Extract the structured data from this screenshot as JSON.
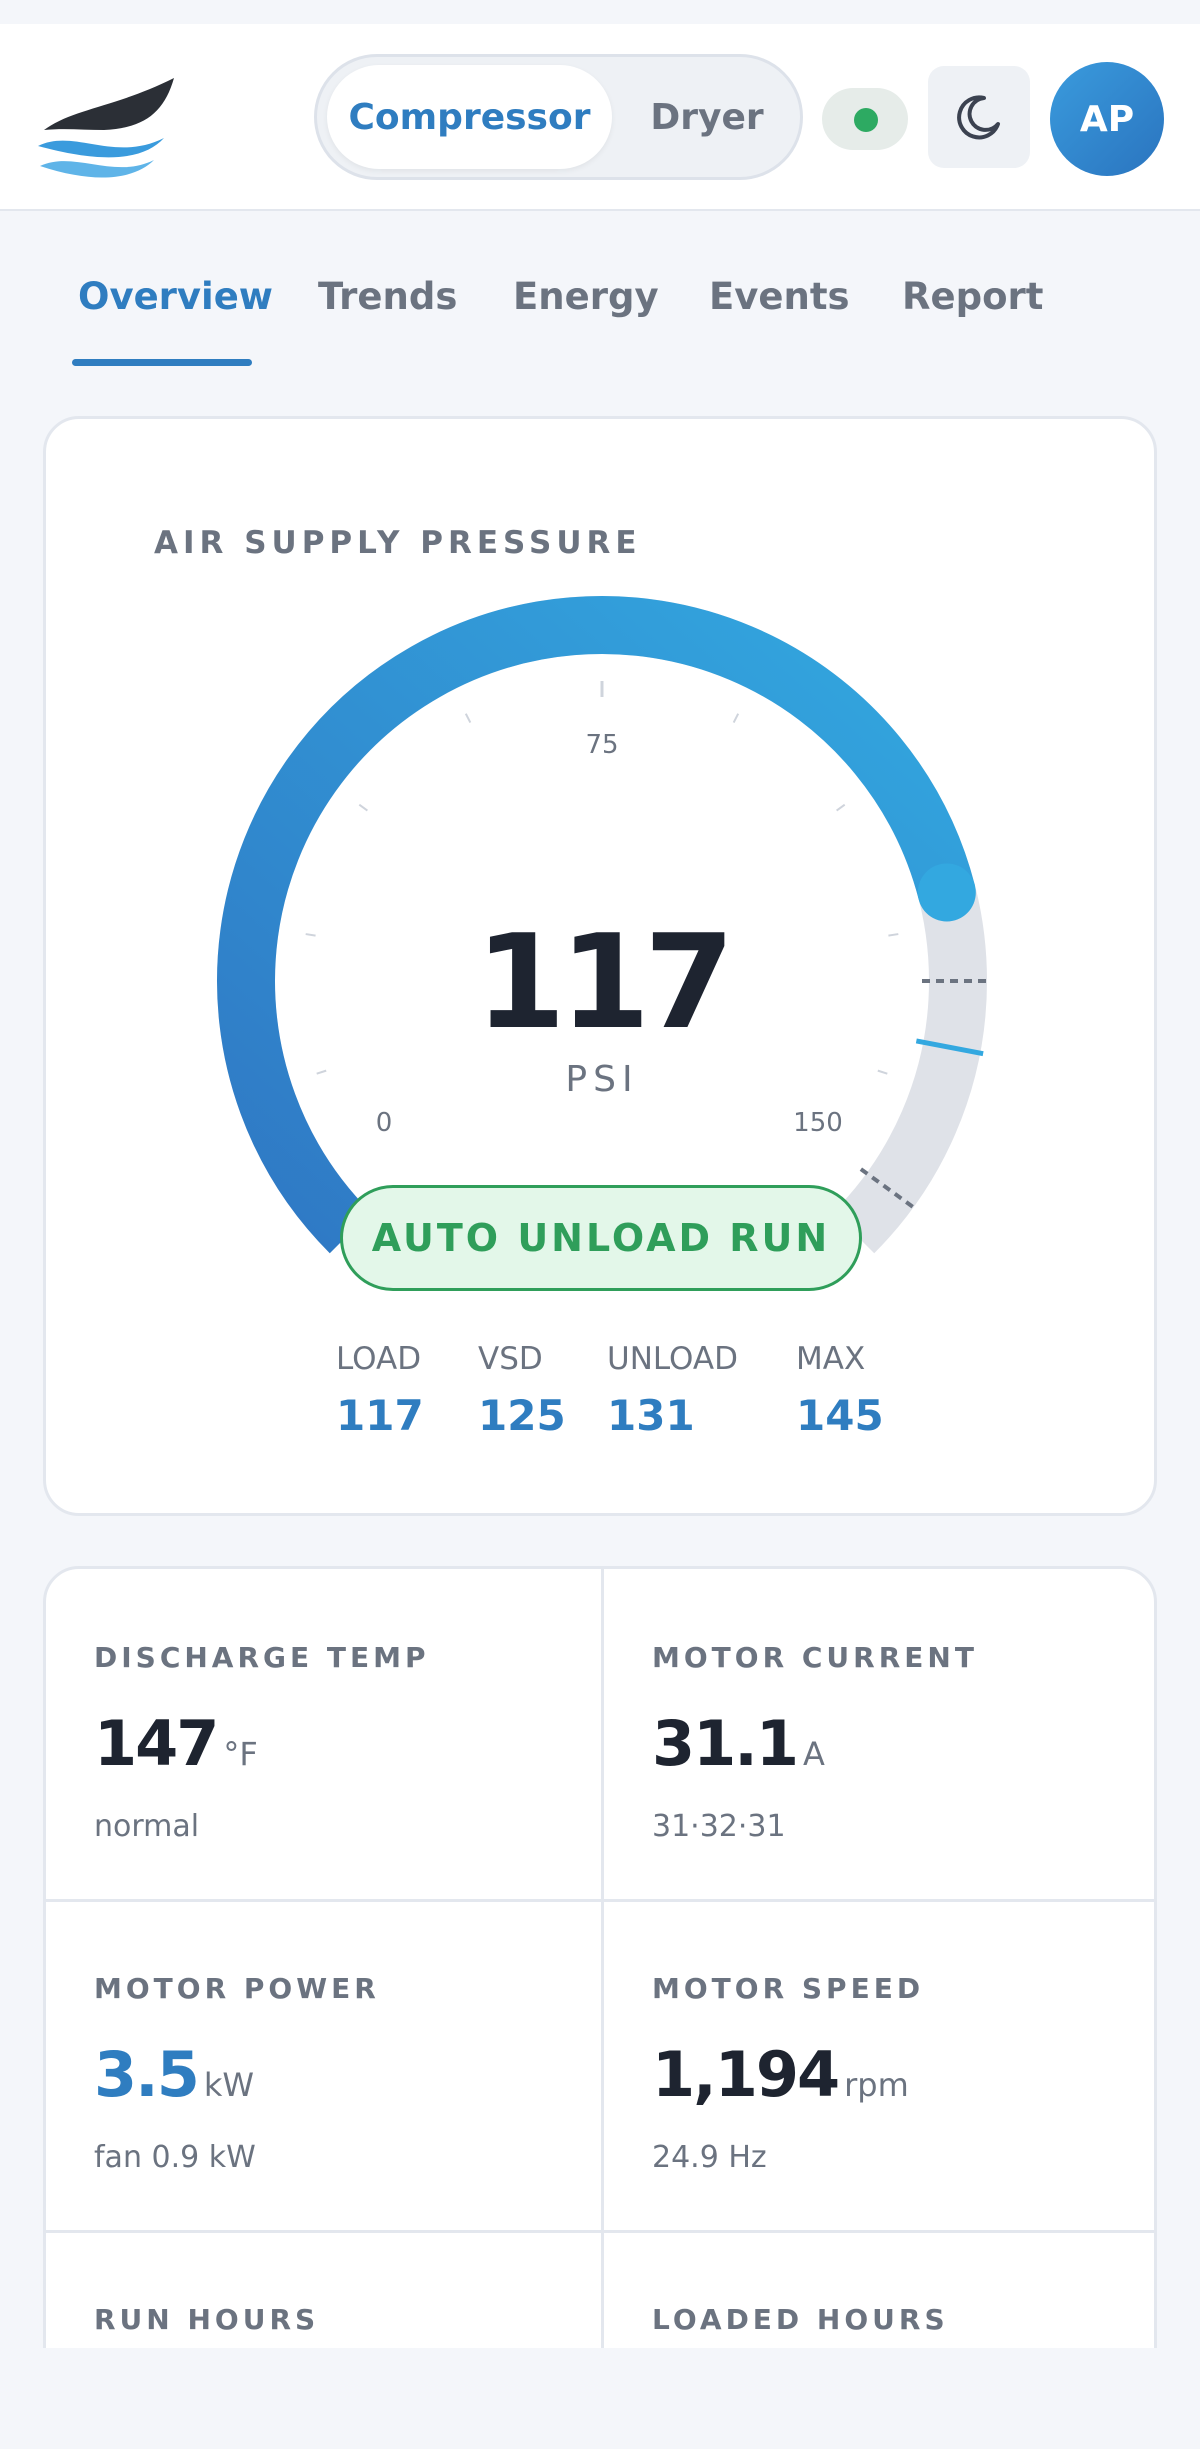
{
  "header": {
    "segments": [
      "Compressor",
      "Dryer"
    ],
    "active_segment": "Compressor",
    "status_color": "#2daa62",
    "theme_icon": "moon-icon",
    "avatar_initials": "AP"
  },
  "tabs": [
    {
      "label": "Overview",
      "active": true
    },
    {
      "label": "Trends",
      "active": false
    },
    {
      "label": "Energy",
      "active": false
    },
    {
      "label": "Events",
      "active": false
    },
    {
      "label": "Report",
      "active": false
    }
  ],
  "gauge": {
    "title": "AIR SUPPLY PRESSURE",
    "value": "117",
    "unit": "PSI",
    "min_label": "0",
    "mid_label": "75",
    "max_label": "150",
    "min": 0,
    "max": 150,
    "reading": 117,
    "mode": "AUTO UNLOAD RUN",
    "setpoints": [
      {
        "label": "LOAD",
        "value": "117"
      },
      {
        "label": "VSD",
        "value": "125"
      },
      {
        "label": "UNLOAD",
        "value": "131"
      },
      {
        "label": "MAX",
        "value": "145"
      }
    ],
    "accent_color": "#2f7dc0",
    "mode_color": "#2f9e5a"
  },
  "metrics": [
    {
      "label": "DISCHARGE TEMP",
      "value": "147",
      "unit": "°F",
      "sub": "normal",
      "accent": false
    },
    {
      "label": "MOTOR CURRENT",
      "value": "31.1",
      "unit": "A",
      "sub": "31·32·31",
      "accent": false
    },
    {
      "label": "MOTOR POWER",
      "value": "3.5",
      "unit": "kW",
      "sub": "fan 0.9 kW",
      "accent": true
    },
    {
      "label": "MOTOR SPEED",
      "value": "1,194",
      "unit": "rpm",
      "sub": "24.9 Hz",
      "accent": false
    },
    {
      "label": "RUN HOURS",
      "value": "",
      "unit": "",
      "sub": "",
      "accent": false
    },
    {
      "label": "LOADED HOURS",
      "value": "",
      "unit": "",
      "sub": "",
      "accent": false
    }
  ]
}
